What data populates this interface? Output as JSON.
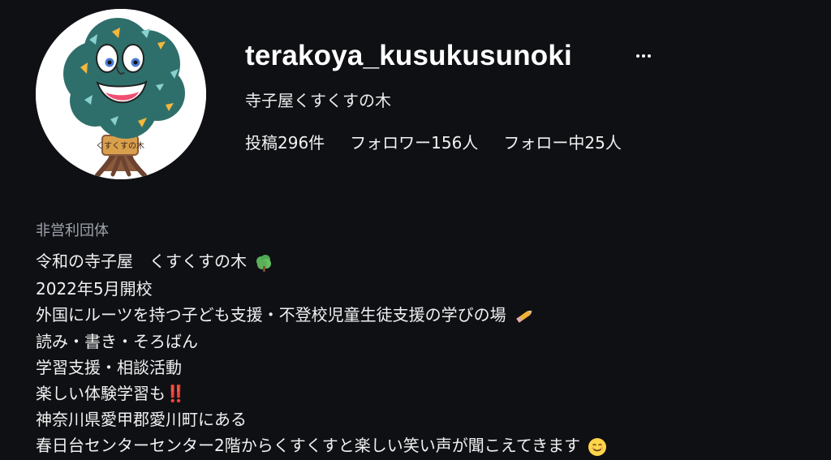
{
  "profile": {
    "username": "terakoya_kusukusunoki",
    "display_name": "寺子屋くすくすの木",
    "avatar_text": "くすくすの木",
    "stats": {
      "posts": "投稿296件",
      "followers": "フォロワー156人",
      "following": "フォロー中25人"
    }
  },
  "bio": {
    "category": "非営利団体",
    "lines": [
      "令和の寺子屋　くすくすの木",
      "2022年5月開校",
      "外国にルーツを持つ子ども支援・不登校児童生徒支援の学びの場",
      "読み・書き・そろばん",
      "学習支援・相談活動",
      "楽しい体験学習も‼️",
      "神奈川県愛甲郡愛川町にある",
      "春日台センターセンター2階からくすくすと楽しい笑い声が聞こえてきます"
    ]
  },
  "icons": {
    "more": "ellipsis-icon",
    "tree": "tree-emoji-icon",
    "pencil": "pencil-emoji-icon",
    "smile": "smiling-face-emoji-icon"
  },
  "colors": {
    "background": "#0f1014",
    "primary_text": "#ffffff",
    "secondary_text": "#9ea3ab",
    "avatar_bg": "#ffffff",
    "tree_canopy": "#2f6f6b",
    "tree_accent": "#f4b73b",
    "trunk": "#8a5a3c"
  }
}
